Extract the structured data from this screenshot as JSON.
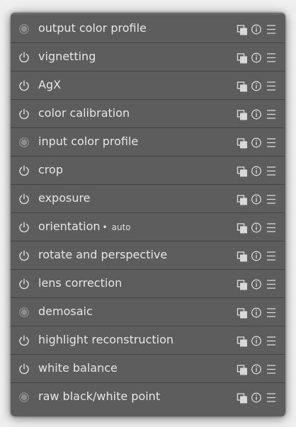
{
  "modules": [
    {
      "label": "output color profile",
      "state": "always-on",
      "suffix": ""
    },
    {
      "label": "vignetting",
      "state": "toggle",
      "suffix": ""
    },
    {
      "label": "AgX",
      "state": "toggle",
      "suffix": ""
    },
    {
      "label": "color calibration",
      "state": "toggle",
      "suffix": ""
    },
    {
      "label": "input color profile",
      "state": "always-on",
      "suffix": ""
    },
    {
      "label": "crop",
      "state": "toggle",
      "suffix": ""
    },
    {
      "label": "exposure",
      "state": "toggle",
      "suffix": ""
    },
    {
      "label": "orientation",
      "state": "toggle",
      "suffix": "auto"
    },
    {
      "label": "rotate and perspective",
      "state": "toggle",
      "suffix": ""
    },
    {
      "label": "lens correction",
      "state": "toggle",
      "suffix": ""
    },
    {
      "label": "demosaic",
      "state": "always-on",
      "suffix": ""
    },
    {
      "label": "highlight reconstruction",
      "state": "toggle",
      "suffix": ""
    },
    {
      "label": "white balance",
      "state": "toggle",
      "suffix": ""
    },
    {
      "label": "raw black/white point",
      "state": "always-on",
      "suffix": ""
    }
  ],
  "auto_bullet": "•",
  "icons": {
    "power": "power-icon",
    "always_on": "always-on-icon",
    "presets": "presets-icon",
    "info": "info-icon",
    "menu": "hamburger-menu-icon"
  },
  "colors": {
    "panel": "#5d5d5d",
    "text": "#e6e6e6",
    "icon": "#d8d8d8"
  }
}
